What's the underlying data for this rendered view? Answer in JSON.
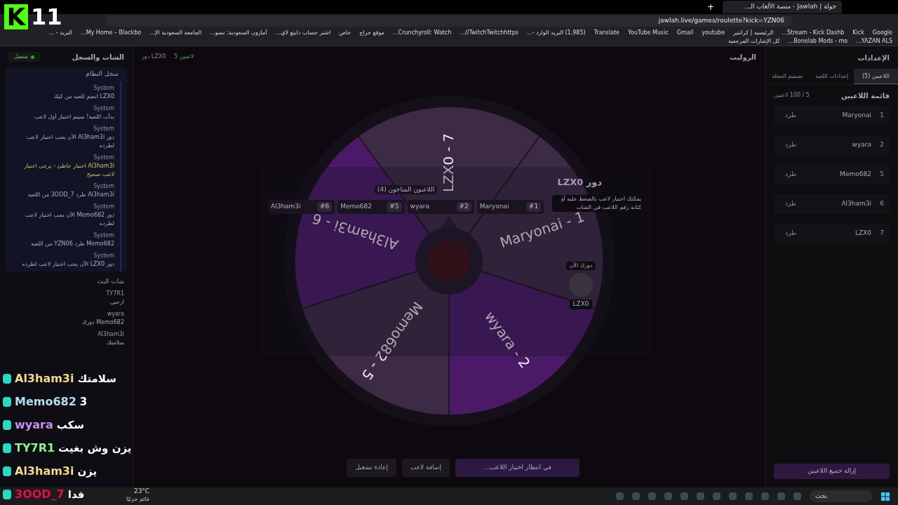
{
  "stream_overlay": {
    "logo": "K",
    "viewers": "11"
  },
  "browser": {
    "new_tab": "+",
    "tab_title": "جولة | Jawlah - منصة الألعاب الـ...",
    "url": "jawlah.live/games/roulette?kick=YZN06",
    "bookmarks": [
      "Google",
      "Kick",
      "Stream - Kick Dashb...",
      "الرئيسية | كرانتير",
      "youtube",
      "Gmail",
      "YouTube Music",
      "Translate",
      "(1,985) البريد الوارد -...",
      "TwitchTwitchhttps//...",
      "Crunchyroll: Watch...",
      "موقع حراج",
      "خاص",
      "اشتر حساب دايتع لاي...",
      "أمازون السعودية: تسو...",
      "الجامعة السعودية الإ...",
      "My Home – Blackbo...",
      "البريد - ...",
      "YAZAN ALS...",
      "Bonelab Mods - mo...",
      "كل الإشارات المرجعية"
    ]
  },
  "left_panel": {
    "title": "الشات والسجل",
    "status": "متصل",
    "log_title": "سجل النظام",
    "log": [
      {
        "sender": "System",
        "text": "LZX0 انضم للعبة من كيك",
        "kind": "info"
      },
      {
        "sender": "System",
        "text": "بدأت اللعبة! سيتم اختيار أول لاعب",
        "kind": "info"
      },
      {
        "sender": "System",
        "text": "دور Al3ham3i الآن يجب اختيار لاعب لطرده",
        "kind": "info"
      },
      {
        "sender": "System",
        "text": "Al3ham3i اختيار خاطئ - يرجى اختيار لاعب صحيح",
        "kind": "warning"
      },
      {
        "sender": "System",
        "text": "Al3ham3i طرد 3OOD_7 من اللعبة",
        "kind": "info"
      },
      {
        "sender": "System",
        "text": "دور Memo682 الآن يجب اختيار لاعب لطرده",
        "kind": "info"
      },
      {
        "sender": "System",
        "text": "Memo682 طرد YZN06 من اللعبة",
        "kind": "info"
      },
      {
        "sender": "System",
        "text": "دور LZX0 الآن يجب اختيار لاعب لطرده",
        "kind": "info"
      }
    ],
    "chat_title": "شات البث",
    "chat": [
      {
        "user": "TY7R1",
        "text": "ارحبي"
      },
      {
        "user": "wyara",
        "text": "Memo682 دورك"
      },
      {
        "user": "Al3ham3i",
        "text": "سلامتك"
      }
    ]
  },
  "center": {
    "title": "الروليت",
    "turn": "دور LZX0",
    "count": "5 لاعبين",
    "wheel": [
      {
        "label": "LZX0 - 7",
        "color": "#3d2a45"
      },
      {
        "label": "Maryonai - 1",
        "color": "#3d2a45"
      },
      {
        "label": "wyara - 2",
        "color": "#4a1a68"
      },
      {
        "label": "Memo682 - 5",
        "color": "#3d2a45"
      },
      {
        "label": "Al3ham3i - 6",
        "color": "#4a1a68"
      }
    ],
    "modal": {
      "title": "دور LZX0",
      "hint": "يمكنك اختيار لاعب بالضغط عليه أو كتابة رقم اللاعب في الشات",
      "available_title": "اللاعبون المتاحون (4)",
      "players": [
        {
          "number": "#1",
          "name": "Maryonai"
        },
        {
          "number": "#2",
          "name": "wyara"
        },
        {
          "number": "#5",
          "name": "Memo682"
        },
        {
          "number": "#6",
          "name": "Al3ham3i"
        }
      ],
      "current_label": "دورك الآن",
      "current_player": "LZX0"
    },
    "buttons": [
      {
        "label": "في انتظار اختيار اللاعب...",
        "kind": "primary"
      },
      {
        "label": "إضافة لاعب",
        "kind": "secondary"
      },
      {
        "label": "إعادة تشغيل",
        "kind": "secondary"
      }
    ]
  },
  "right_panel": {
    "title": "الإعدادات",
    "tabs": [
      {
        "label": "اللاعبين (5)",
        "selected": true
      },
      {
        "label": "إعدادات اللعبة",
        "selected": false
      },
      {
        "label": "تصميم العجلة",
        "selected": false
      }
    ],
    "list_title": "قائمة اللاعبين",
    "capacity": "5 / 100 لاعبين",
    "players": [
      {
        "number": "1",
        "name": "Maryonai",
        "action": "طرد"
      },
      {
        "number": "2",
        "name": "wyara",
        "action": "طرد"
      },
      {
        "number": "5",
        "name": "Memo682",
        "action": "طرد"
      },
      {
        "number": "6",
        "name": "Al3ham3i",
        "action": "طرد"
      },
      {
        "number": "7",
        "name": "LZX0",
        "action": "طرد"
      }
    ],
    "clear_button": "إزالة جميع اللاعبين"
  },
  "stream_chat": [
    {
      "user": "Al3ham3i",
      "color": "#f0d890",
      "text": "سلامتك"
    },
    {
      "user": "Memo682",
      "color": "#b8daf0",
      "text": "3"
    },
    {
      "user": "wyara",
      "color": "#c890f0",
      "text": "سكب"
    },
    {
      "user": "TY7R1",
      "color": "#90f090",
      "text": "يزن وش بغيت"
    },
    {
      "user": "Al3ham3i",
      "color": "#f0d890",
      "text": "يزن"
    },
    {
      "user": "3OOD_7",
      "color": "#e0104a",
      "text": "فدا"
    }
  ],
  "taskbar": {
    "weather": "23°C",
    "weather_text": "غائم جزئيًا",
    "search": "بحث"
  }
}
